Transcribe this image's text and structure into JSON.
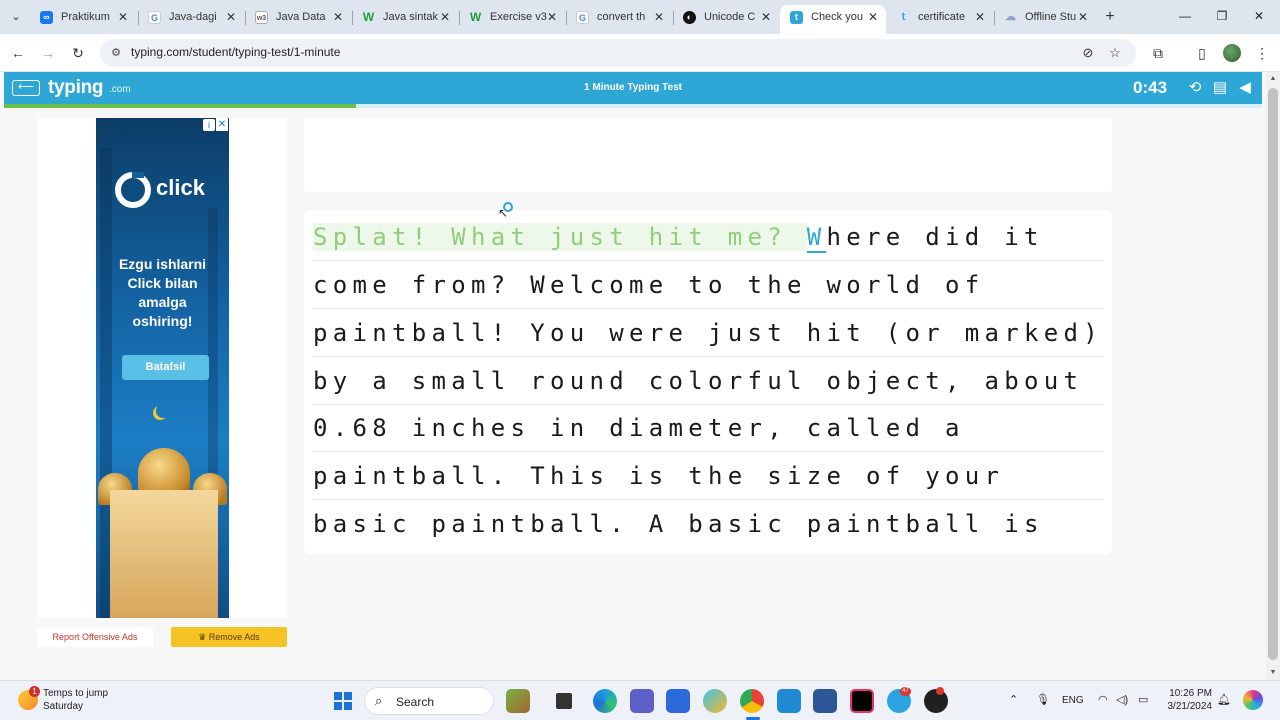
{
  "browser": {
    "tabs": [
      {
        "title": "Praktikum",
        "icon": "meta-icon",
        "color": "#1877f2"
      },
      {
        "title": "Java-dagi",
        "icon": "google-icon",
        "color": "#4285f4"
      },
      {
        "title": "Java Data",
        "icon": "w3schools-icon",
        "color": "#7a7a7a"
      },
      {
        "title": "Java sintak",
        "icon": "w-green-icon",
        "color": "#1f9d3a"
      },
      {
        "title": "Exercise v3",
        "icon": "w-green-icon",
        "color": "#1f9d3a"
      },
      {
        "title": "convert th",
        "icon": "google-icon",
        "color": "#4285f4"
      },
      {
        "title": "Unicode C",
        "icon": "unicode-icon",
        "color": "#111111"
      },
      {
        "title": "Check you",
        "icon": "typing-icon",
        "color": "#2ea6d6"
      },
      {
        "title": "certificate",
        "icon": "typing-icon",
        "color": "#2ea6d6"
      },
      {
        "title": "Offline Stu",
        "icon": "cloud-icon",
        "color": "#8fa4c4"
      }
    ],
    "active_tab_index": 7,
    "url": "typing.com/student/typing-test/1-minute"
  },
  "header": {
    "logo": "typing",
    "logo_suffix": ".com",
    "title": "1 Minute Typing Test",
    "timer": "0:43",
    "progress_fraction": 0.28,
    "brand_color": "#2ea6d6",
    "progress_color": "#6cc04a"
  },
  "ad": {
    "brand": "click",
    "tagline_lines": [
      "Ezgu ishlarni",
      "Click bilan",
      "amalga",
      "oshiring!"
    ],
    "button": "Batafsil",
    "info_icon": "i",
    "close_icon": "✕"
  },
  "ad_links": {
    "report": "Report Offensive Ads",
    "remove": "Remove Ads",
    "remove_icon": "♛"
  },
  "typing": {
    "lines": [
      {
        "typed": "Splat! What just hit me? ",
        "current": "W",
        "rest": "here did it"
      },
      {
        "text": "come from? Welcome to the world of"
      },
      {
        "text": "paintball! You were just hit (or marked)"
      },
      {
        "text": "by a small round colorful object, about"
      },
      {
        "text": "0.68 inches in diameter, called a"
      },
      {
        "text": "paintball. This is the size of your"
      },
      {
        "text": "basic paintball. A basic paintball is"
      }
    ],
    "typed_color": "#8fce7a",
    "cursor_color": "#2ea6d6"
  },
  "taskbar": {
    "weather_line1": "Temps to jump",
    "weather_line2": "Saturday",
    "weather_badge": "1",
    "search": "Search",
    "lang": "ENG",
    "time": "10:26 PM",
    "date": "3/21/2024",
    "telegram_badge": "47"
  }
}
